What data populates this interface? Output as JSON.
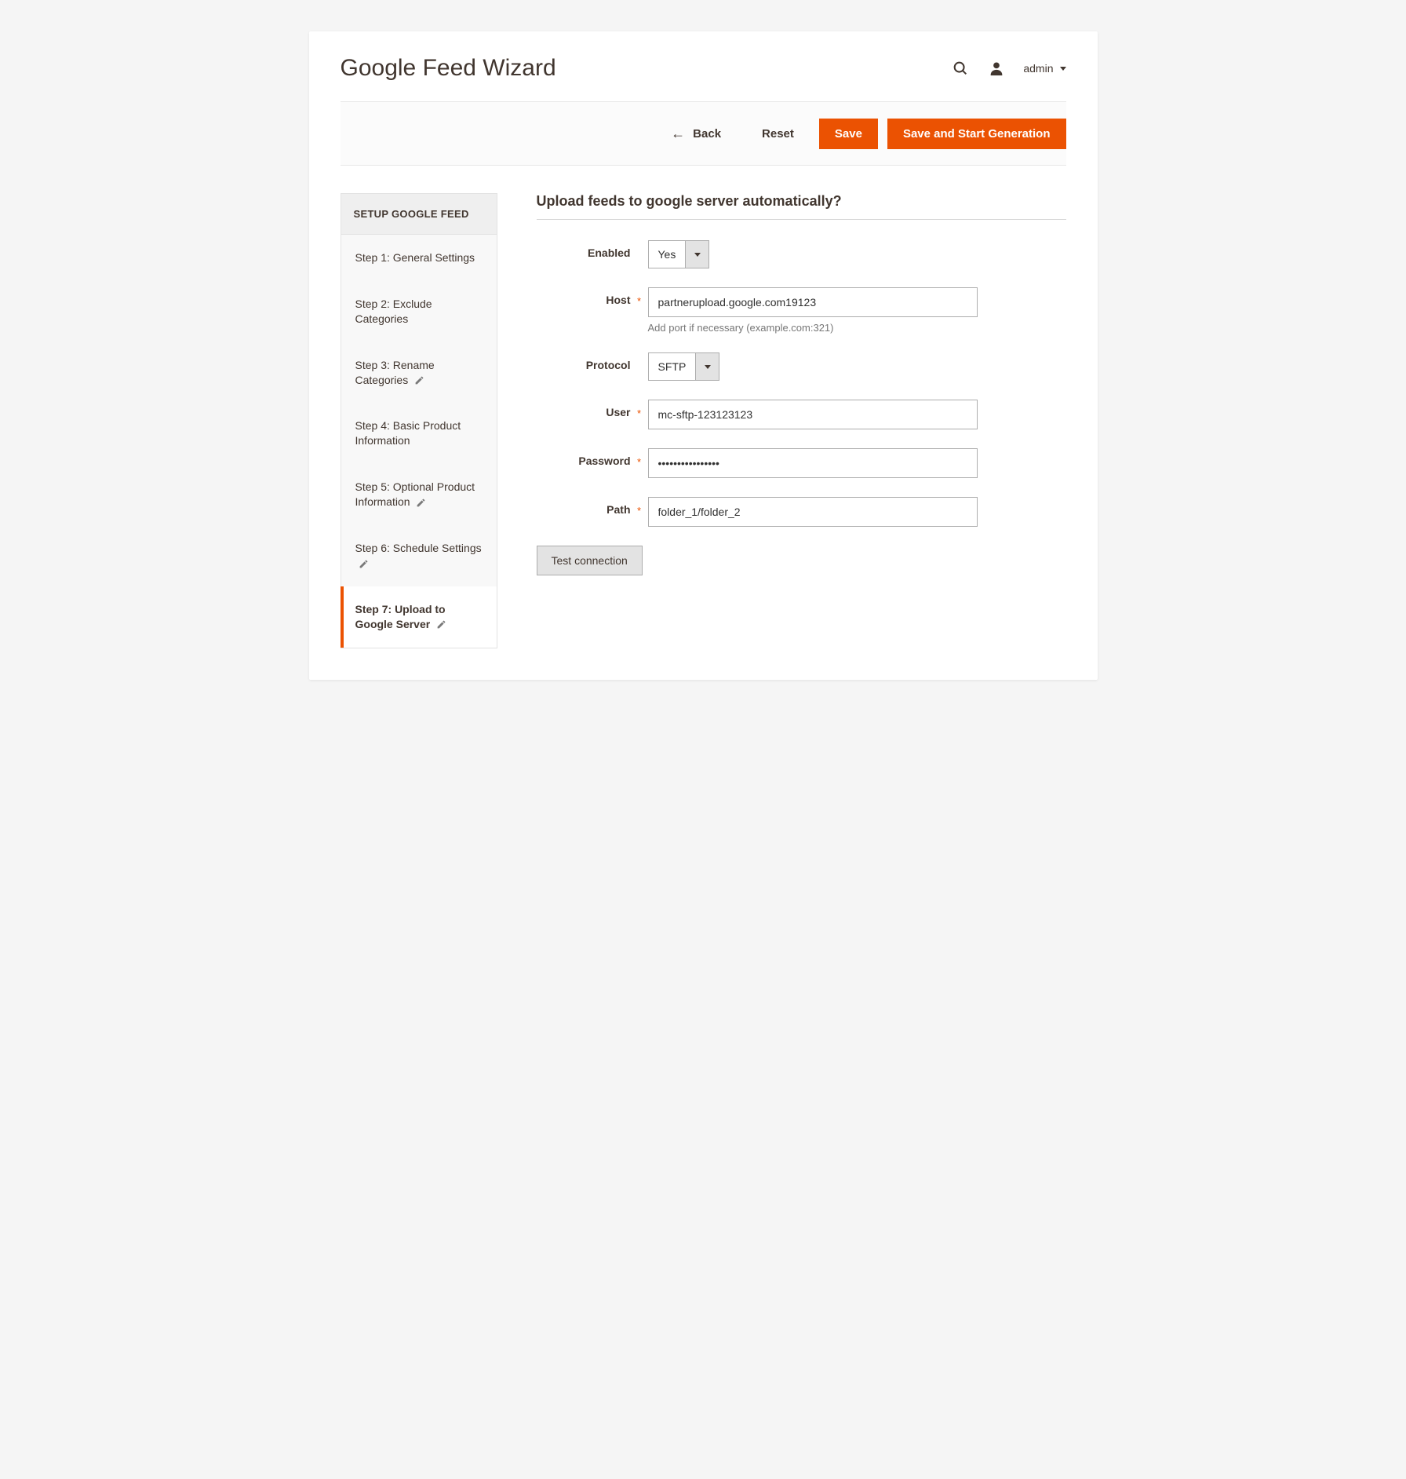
{
  "header": {
    "title": "Google Feed Wizard",
    "admin_label": "admin"
  },
  "actions": {
    "back": "Back",
    "reset": "Reset",
    "save": "Save",
    "save_start": "Save and Start Generation"
  },
  "sidebar": {
    "header": "SETUP GOOGLE FEED",
    "items": [
      {
        "label": "Step 1: General Settings",
        "editable": false,
        "active": false
      },
      {
        "label": "Step 2: Exclude Categories",
        "editable": false,
        "active": false
      },
      {
        "label": "Step 3: Rename Categories",
        "editable": true,
        "active": false
      },
      {
        "label": "Step 4: Basic Product Information",
        "editable": false,
        "active": false
      },
      {
        "label": "Step 5: Optional Product Information",
        "editable": true,
        "active": false
      },
      {
        "label": "Step 6: Schedule Settings",
        "editable": true,
        "active": false
      },
      {
        "label": "Step 7: Upload to Google Server",
        "editable": true,
        "active": true
      }
    ]
  },
  "form": {
    "section_title": "Upload feeds to google server automatically?",
    "enabled": {
      "label": "Enabled",
      "value": "Yes"
    },
    "host": {
      "label": "Host",
      "value": "partnerupload.google.com19123",
      "hint": "Add port if necessary (example.com:321)"
    },
    "protocol": {
      "label": "Protocol",
      "value": "SFTP"
    },
    "user": {
      "label": "User",
      "value": "mc-sftp-123123123"
    },
    "password": {
      "label": "Password",
      "value": "••••••••••••••••"
    },
    "path": {
      "label": "Path",
      "value": "folder_1/folder_2"
    },
    "test_button": "Test connection"
  }
}
